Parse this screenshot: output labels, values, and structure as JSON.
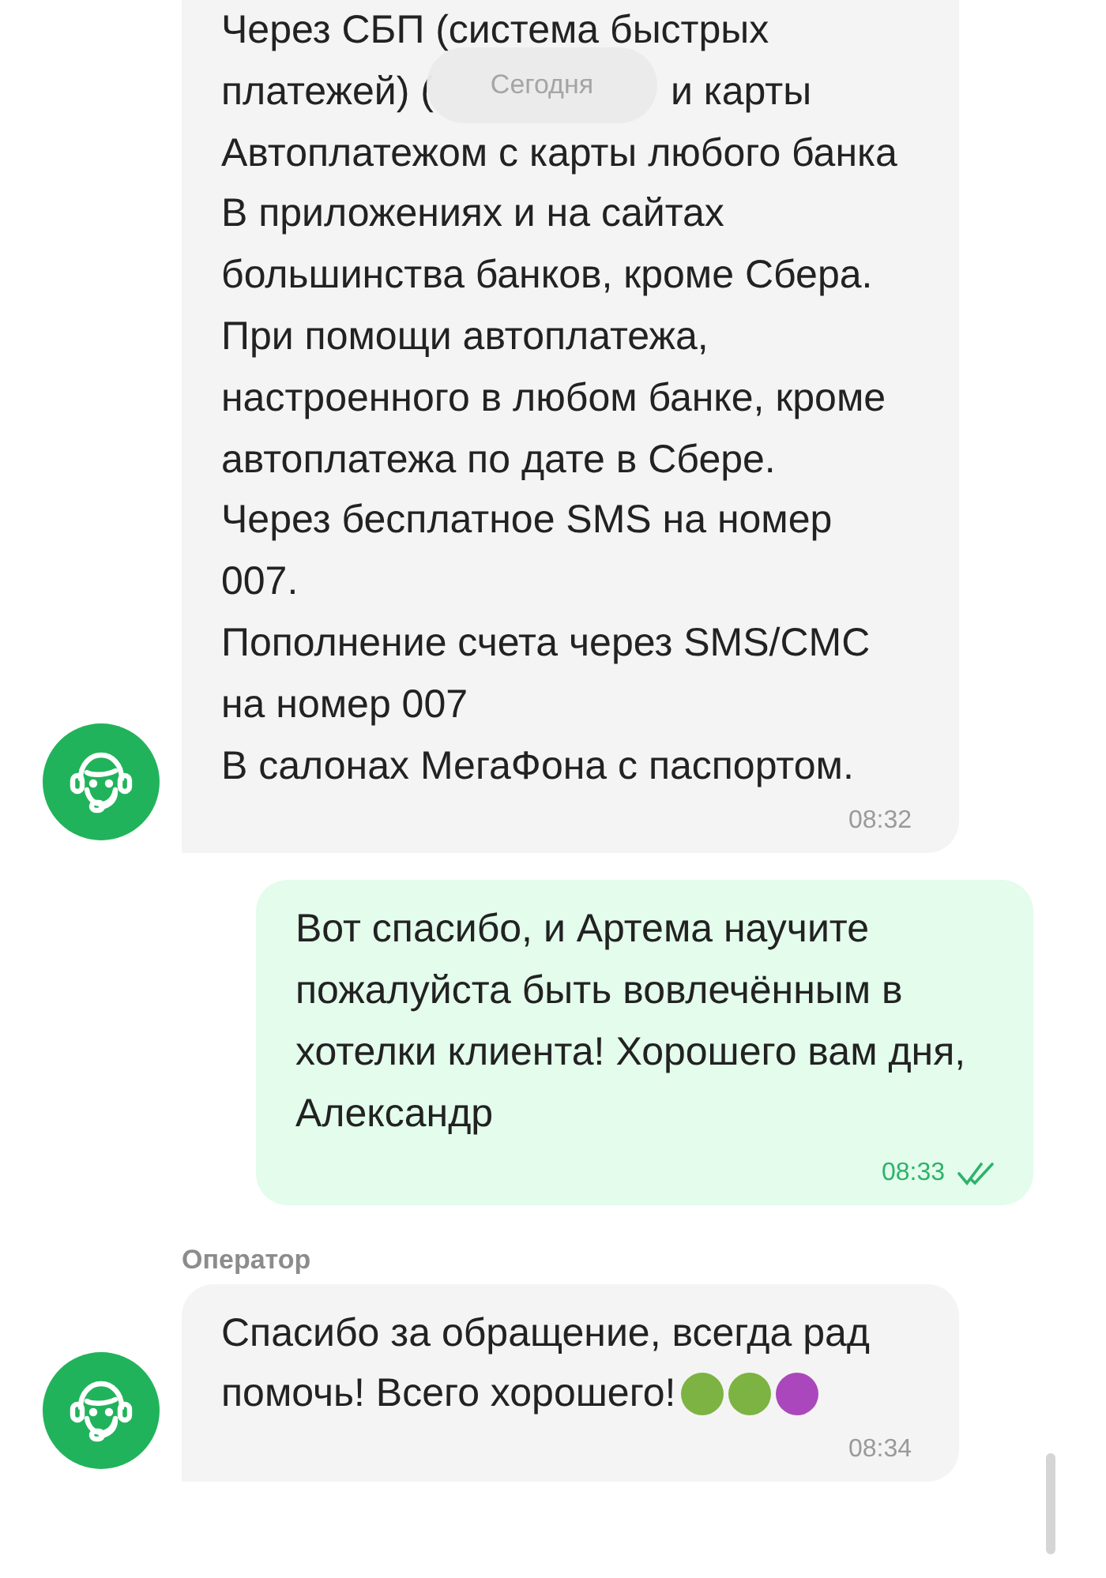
{
  "date_pill": "Сегодня",
  "messages": [
    {
      "kind": "incoming",
      "lines": [
        {
          "text": "Через СБП (система быстрых"
        },
        {
          "text": "платежей) (",
          "after_pill": "и карты"
        },
        {
          "text": "Автоплатежом с карты любого банка"
        },
        {
          "text": "В приложениях и на сайтах"
        },
        {
          "text": "большинства банков, кроме Сбера."
        },
        {
          "text": "При помощи автоплатежа,"
        },
        {
          "text": "настроенного в любом банке, кроме"
        },
        {
          "text": "автоплатежа по дате в Сбере."
        },
        {
          "text": "Через бесплатное SMS на номер"
        },
        {
          "text": "007."
        },
        {
          "text": "Пополнение счета через SMS/CMC"
        },
        {
          "text": "на номер 007"
        },
        {
          "text": "В салонах МегаФона с паспортом."
        }
      ],
      "time": "08:32"
    },
    {
      "kind": "outgoing",
      "lines": [
        {
          "text": "Вот спасибо, и Артема научите"
        },
        {
          "text": "пожалуйста быть вовлечённым в"
        },
        {
          "text": "хотелки клиента! Хорошего вам дня,"
        },
        {
          "text": "Александр"
        }
      ],
      "time": "08:33",
      "read": true
    },
    {
      "kind": "incoming",
      "author": "Оператор",
      "lines": [
        {
          "text": "Спасибо за обращение, всегда рад"
        },
        {
          "text": "помочь! Всего хорошего!",
          "emoji": [
            {
              "color": "#7cb342"
            },
            {
              "color": "#7cb342"
            },
            {
              "color": "#ab47bc"
            }
          ]
        }
      ],
      "time": "08:34"
    }
  ]
}
